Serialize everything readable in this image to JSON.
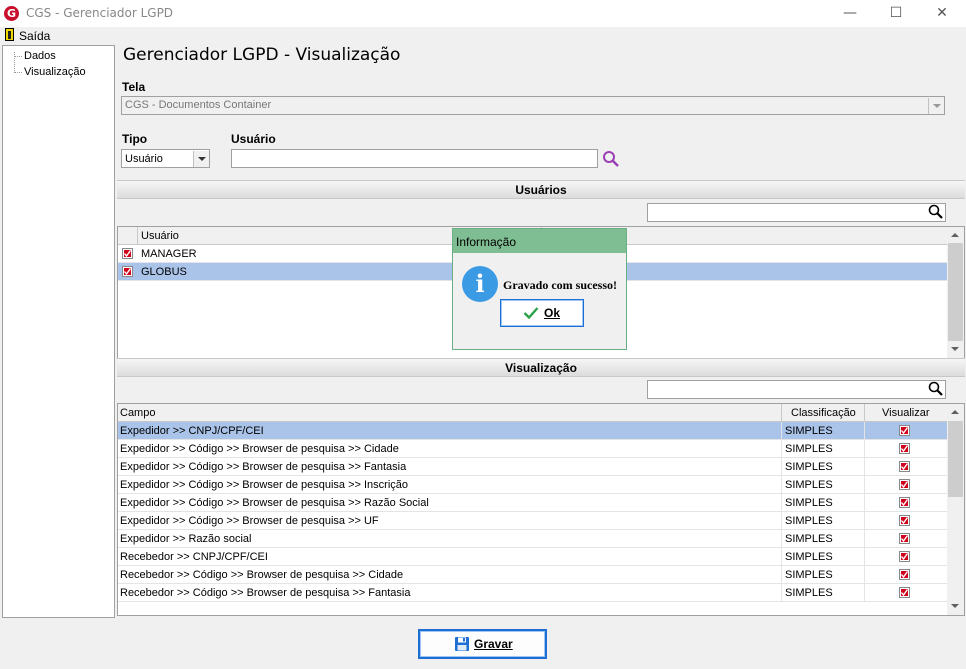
{
  "window": {
    "title": "CGS - Gerenciador LGPD",
    "logo_letter": "G"
  },
  "menu": {
    "exit_label": "Saída"
  },
  "tree": {
    "items": [
      "Dados",
      "Visualização"
    ]
  },
  "page": {
    "title": "Gerenciador LGPD - Visualização"
  },
  "form": {
    "tela_label": "Tela",
    "tela_value": "CGS - Documentos Container",
    "tipo_label": "Tipo",
    "tipo_value": "Usuário",
    "usuario_label": "Usuário",
    "usuario_value": ""
  },
  "users_section": {
    "title": "Usuários",
    "filter_value": "",
    "column": "Usuário",
    "rows": [
      {
        "name": "MANAGER",
        "checked": true,
        "selected": false
      },
      {
        "name": "GLOBUS",
        "checked": true,
        "selected": true
      }
    ]
  },
  "view_section": {
    "title": "Visualização",
    "filter_value": "",
    "columns": [
      "Campo",
      "Classificação",
      "Visualizar"
    ],
    "rows": [
      {
        "campo": "Expedidor >> CNPJ/CPF/CEI",
        "classificacao": "SIMPLES",
        "visualizar": true,
        "selected": true
      },
      {
        "campo": "Expedidor >> Código >> Browser de pesquisa >> Cidade",
        "classificacao": "SIMPLES",
        "visualizar": true,
        "selected": false
      },
      {
        "campo": "Expedidor >> Código >> Browser de pesquisa >> Fantasia",
        "classificacao": "SIMPLES",
        "visualizar": true,
        "selected": false
      },
      {
        "campo": "Expedidor >> Código >> Browser de pesquisa >> Inscrição",
        "classificacao": "SIMPLES",
        "visualizar": true,
        "selected": false
      },
      {
        "campo": "Expedidor >> Código >> Browser de pesquisa >> Razão Social",
        "classificacao": "SIMPLES",
        "visualizar": true,
        "selected": false
      },
      {
        "campo": "Expedidor >> Código >> Browser de pesquisa >> UF",
        "classificacao": "SIMPLES",
        "visualizar": true,
        "selected": false
      },
      {
        "campo": "Expedidor >> Razão social",
        "classificacao": "SIMPLES",
        "visualizar": true,
        "selected": false
      },
      {
        "campo": "Recebedor >> CNPJ/CPF/CEI",
        "classificacao": "SIMPLES",
        "visualizar": true,
        "selected": false
      },
      {
        "campo": "Recebedor >> Código >> Browser de pesquisa >> Cidade",
        "classificacao": "SIMPLES",
        "visualizar": true,
        "selected": false
      },
      {
        "campo": "Recebedor >> Código >> Browser de pesquisa >> Fantasia",
        "classificacao": "SIMPLES",
        "visualizar": true,
        "selected": false
      }
    ]
  },
  "dialog": {
    "title": "Informação",
    "message": "Gravado com sucesso!",
    "ok_label": "Ok"
  },
  "footer": {
    "save_label": "Gravar"
  },
  "colors": {
    "selection": "#aac3e9",
    "dialog_header": "#7fbe92",
    "accent": "#1e6fd3",
    "check": "#d0021b"
  }
}
